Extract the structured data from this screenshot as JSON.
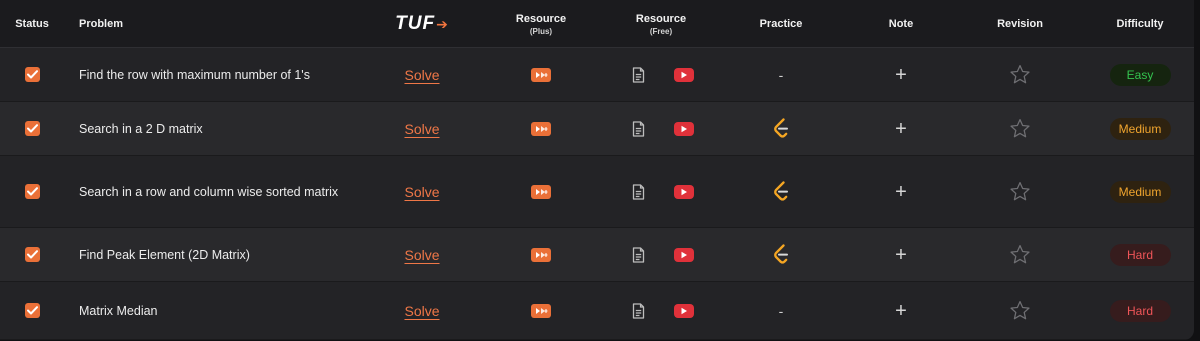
{
  "header": {
    "status": "Status",
    "problem": "Problem",
    "logo": "TUF",
    "resource_plus": "Resource",
    "resource_plus_sub": "(Plus)",
    "resource_free": "Resource",
    "resource_free_sub": "(Free)",
    "practice": "Practice",
    "note": "Note",
    "revision": "Revision",
    "difficulty": "Difficulty"
  },
  "colors": {
    "accent": "#ea7038",
    "youtube": "#e0313a",
    "easy": "#34c34f",
    "medium": "#f1a52e",
    "hard": "#ef5558"
  },
  "rows": [
    {
      "checked": true,
      "problem": "Find the row with maximum number of 1's",
      "solve": "Solve",
      "practice": "-",
      "practice_icon": "none",
      "note": "+",
      "difficulty": "Easy",
      "difficulty_level": "easy"
    },
    {
      "checked": true,
      "problem": "Search in a 2 D matrix",
      "solve": "Solve",
      "practice": "",
      "practice_icon": "leetcode-icon",
      "note": "+",
      "difficulty": "Medium",
      "difficulty_level": "medium"
    },
    {
      "checked": true,
      "problem": "Search in a row and column wise sorted matrix",
      "solve": "Solve",
      "practice": "",
      "practice_icon": "leetcode-icon",
      "note": "+",
      "difficulty": "Medium",
      "difficulty_level": "medium"
    },
    {
      "checked": true,
      "problem": "Find Peak Element (2D Matrix)",
      "solve": "Solve",
      "practice": "",
      "practice_icon": "leetcode-icon",
      "note": "+",
      "difficulty": "Hard",
      "difficulty_level": "hard"
    },
    {
      "checked": true,
      "problem": "Matrix Median",
      "solve": "Solve",
      "practice": "-",
      "practice_icon": "none",
      "note": "+",
      "difficulty": "Hard",
      "difficulty_level": "hard"
    }
  ]
}
